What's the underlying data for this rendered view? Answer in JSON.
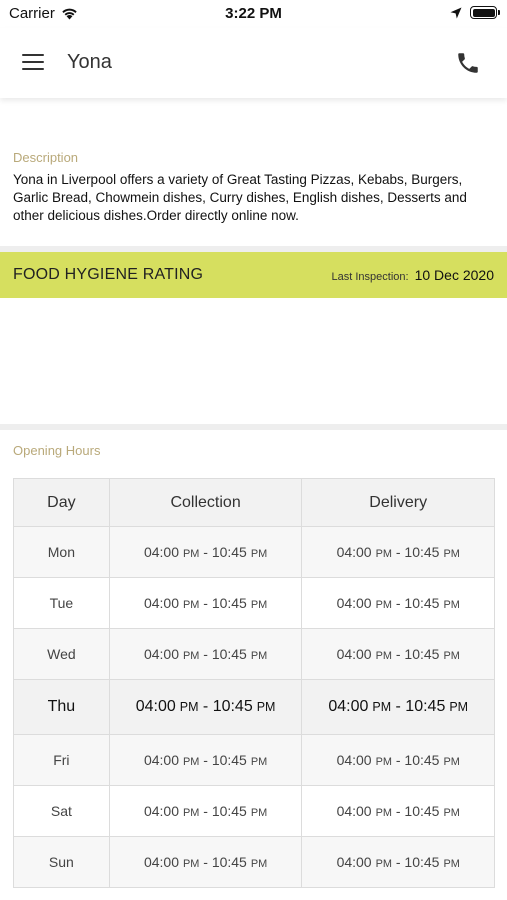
{
  "status_bar": {
    "carrier": "Carrier",
    "time": "3:22 PM"
  },
  "header": {
    "title": "Yona",
    "menu_icon": "hamburger-menu-icon",
    "phone_icon": "phone-icon"
  },
  "description": {
    "label": "Description",
    "text": "Yona in Liverpool offers a variety of Great Tasting Pizzas, Kebabs, Burgers, Garlic Bread, Chowmein dishes, Curry dishes, English dishes, Desserts and other delicious dishes.Order directly online now."
  },
  "hygiene": {
    "title": "FOOD HYGIENE RATING",
    "last_inspection_label": "Last Inspection:",
    "last_inspection_date": "10 Dec 2020",
    "color": "#d6df5f"
  },
  "opening_hours": {
    "label": "Opening Hours",
    "headers": [
      "Day",
      "Collection",
      "Delivery"
    ],
    "rows": [
      {
        "day": "Mon",
        "collection": {
          "from": "04:00",
          "from_ampm": "PM",
          "to": "10:45",
          "to_ampm": "PM"
        },
        "delivery": {
          "from": "04:00",
          "from_ampm": "PM",
          "to": "10:45",
          "to_ampm": "PM"
        }
      },
      {
        "day": "Tue",
        "collection": {
          "from": "04:00",
          "from_ampm": "PM",
          "to": "10:45",
          "to_ampm": "PM"
        },
        "delivery": {
          "from": "04:00",
          "from_ampm": "PM",
          "to": "10:45",
          "to_ampm": "PM"
        }
      },
      {
        "day": "Wed",
        "collection": {
          "from": "04:00",
          "from_ampm": "PM",
          "to": "10:45",
          "to_ampm": "PM"
        },
        "delivery": {
          "from": "04:00",
          "from_ampm": "PM",
          "to": "10:45",
          "to_ampm": "PM"
        }
      },
      {
        "day": "Thu",
        "collection": {
          "from": "04:00",
          "from_ampm": "PM",
          "to": "10:45",
          "to_ampm": "PM"
        },
        "delivery": {
          "from": "04:00",
          "from_ampm": "PM",
          "to": "10:45",
          "to_ampm": "PM"
        }
      },
      {
        "day": "Fri",
        "collection": {
          "from": "04:00",
          "from_ampm": "PM",
          "to": "10:45",
          "to_ampm": "PM"
        },
        "delivery": {
          "from": "04:00",
          "from_ampm": "PM",
          "to": "10:45",
          "to_ampm": "PM"
        }
      },
      {
        "day": "Sat",
        "collection": {
          "from": "04:00",
          "from_ampm": "PM",
          "to": "10:45",
          "to_ampm": "PM"
        },
        "delivery": {
          "from": "04:00",
          "from_ampm": "PM",
          "to": "10:45",
          "to_ampm": "PM"
        }
      },
      {
        "day": "Sun",
        "collection": {
          "from": "04:00",
          "from_ampm": "PM",
          "to": "10:45",
          "to_ampm": "PM"
        },
        "delivery": {
          "from": "04:00",
          "from_ampm": "PM",
          "to": "10:45",
          "to_ampm": "PM"
        }
      }
    ]
  }
}
